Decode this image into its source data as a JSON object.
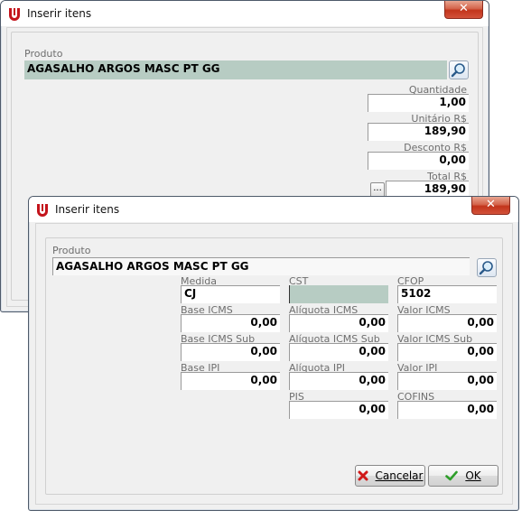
{
  "back_window": {
    "title": "Inserir itens",
    "close_label": "✕",
    "produto_label": "Produto",
    "produto_value": "AGASALHO ARGOS MASC PT GG",
    "quantidade_label": "Quantidade",
    "quantidade_value": "1,00",
    "unitario_label": "Unitário R$",
    "unitario_value": "189,90",
    "desconto_label": "Desconto R$",
    "desconto_value": "0,00",
    "total_label": "Total R$",
    "total_value": "189,90",
    "ellipsis_label": "..."
  },
  "front_window": {
    "title": "Inserir itens",
    "close_label": "✕",
    "produto_label": "Produto",
    "produto_value": "AGASALHO ARGOS MASC PT GG",
    "medida_label": "Medida",
    "medida_value": "CJ",
    "cst_label": "CST",
    "cst_value": "",
    "cfop_label": "CFOP",
    "cfop_value": "5102",
    "base_icms_label": "Base ICMS",
    "base_icms_value": "0,00",
    "aliquota_icms_label": "Alíquota ICMS",
    "aliquota_icms_value": "0,00",
    "valor_icms_label": "Valor ICMS",
    "valor_icms_value": "0,00",
    "base_icms_sub_label": "Base ICMS Sub",
    "base_icms_sub_value": "0,00",
    "aliquota_icms_sub_label": "Alíquota ICMS Sub",
    "aliquota_icms_sub_value": "0,00",
    "valor_icms_sub_label": "Valor ICMS Sub",
    "valor_icms_sub_value": "0,00",
    "base_ipi_label": "Base IPI",
    "base_ipi_value": "0,00",
    "aliquota_ipi_label": "Alíquota IPI",
    "aliquota_ipi_value": "0,00",
    "valor_ipi_label": "Valor IPI",
    "valor_ipi_value": "0,00",
    "pis_label": "PIS",
    "pis_value": "0,00",
    "cofins_label": "COFINS",
    "cofins_value": "0,00",
    "cancelar_label": "Cancelar",
    "ok_label": "OK"
  },
  "icons": {
    "app": "app-logo-icon",
    "search": "magnifier-icon",
    "cancel": "red-x-icon",
    "ok": "green-check-icon"
  },
  "colors": {
    "teal_field": "#b7ccc3",
    "close_red": "#c2341b"
  }
}
